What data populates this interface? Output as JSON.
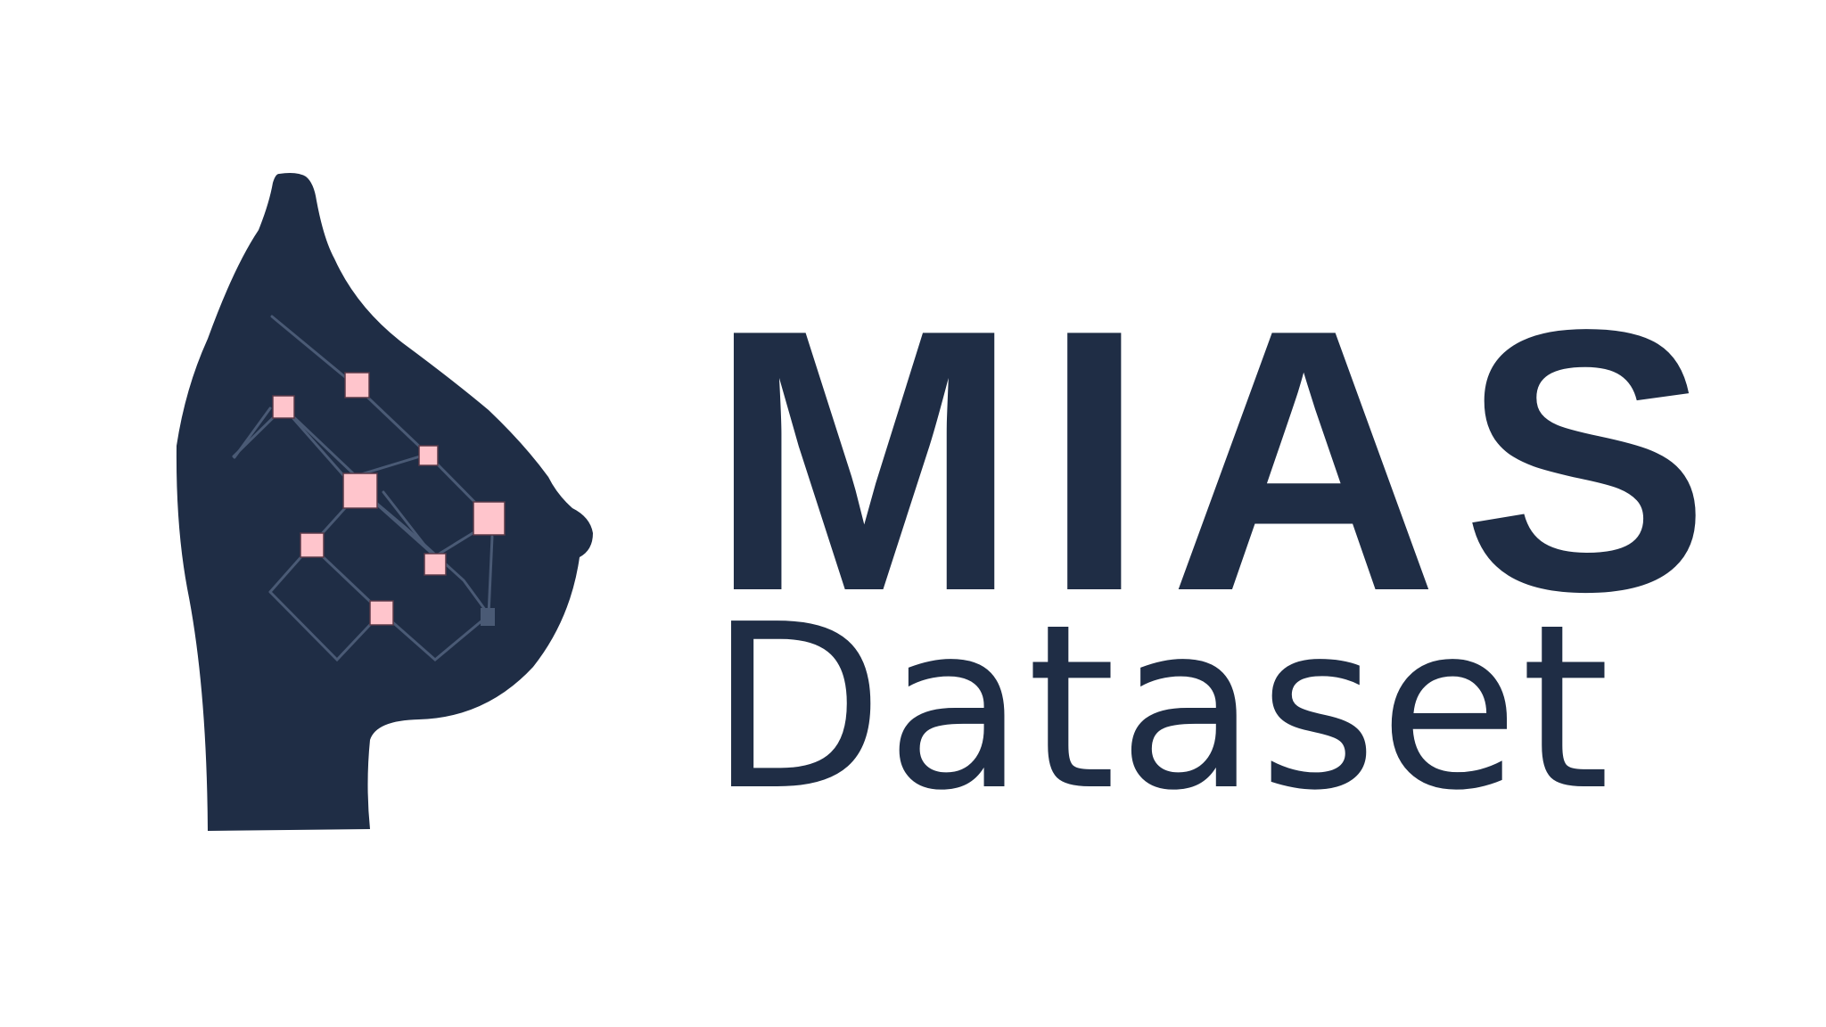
{
  "logo": {
    "title": "MIAS",
    "subtitle": "Dataset",
    "icon": "breast-silhouette-network-icon"
  },
  "colors": {
    "background": "#ffffff",
    "navy": "#1f2d45",
    "node_pink": "#ffc5cc",
    "node_outline": "#5a3a48",
    "line_color": "#4a5a75"
  }
}
